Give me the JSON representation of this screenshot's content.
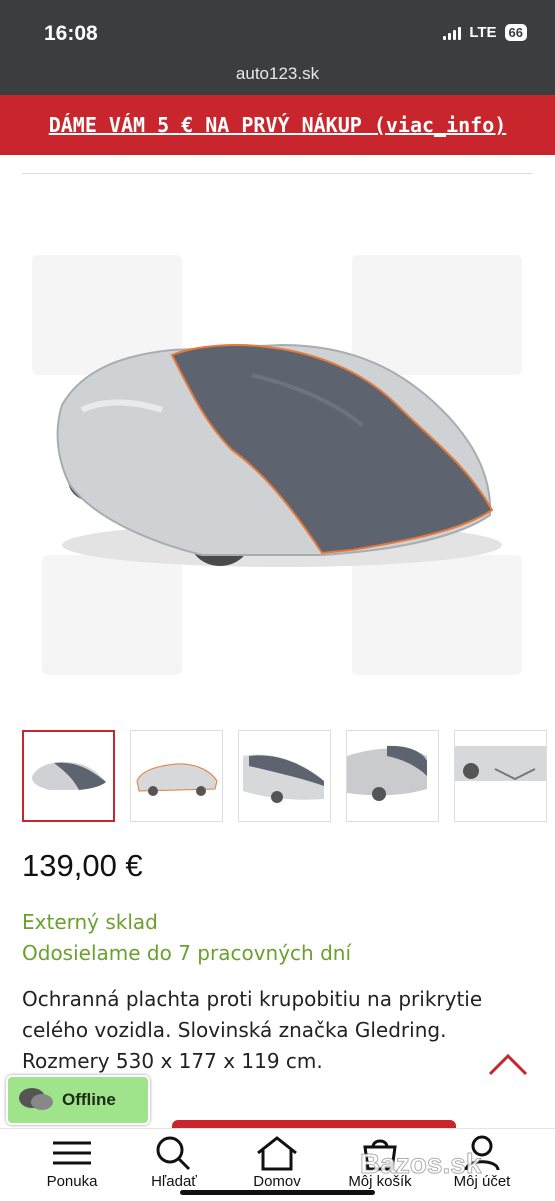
{
  "status_bar": {
    "time": "16:08",
    "network": "LTE",
    "battery": "66"
  },
  "browser": {
    "url": "auto123.sk"
  },
  "promo": {
    "text": "DÁME VÁM 5 € NA PRVÝ NÁKUP (viac_info)"
  },
  "product": {
    "image_icon": "car-cover-image",
    "thumbnails": [
      {
        "icon": "car-cover-thumbnail",
        "selected": true
      },
      {
        "icon": "car-cover-side-thumbnail",
        "selected": false
      },
      {
        "icon": "car-cover-front-thumbnail",
        "selected": false
      },
      {
        "icon": "car-cover-closeup-thumbnail",
        "selected": false
      },
      {
        "icon": "car-cover-wheel-thumbnail",
        "selected": false
      }
    ],
    "price": "139,00 €",
    "stock_status": "Externý sklad",
    "shipping": "Odosielame do 7 pracovných dní",
    "description": "Ochranná plachta proti krupobitiu na prikrytie celého vozidla. Slovinská značka Gledring. Rozmery 530 x 177 x 119 cm."
  },
  "chat": {
    "label": "Offline",
    "icon": "chat-bubbles-icon"
  },
  "bottom_nav": [
    {
      "label": "Ponuka",
      "icon": "menu-icon"
    },
    {
      "label": "Hľadať",
      "icon": "search-icon"
    },
    {
      "label": "Domov",
      "icon": "home-icon"
    },
    {
      "label": "Môj košík",
      "icon": "cart-icon"
    },
    {
      "label": "Môj účet",
      "icon": "user-icon"
    }
  ],
  "watermark": "Bazos.sk",
  "colors": {
    "accent_red": "#c8252c",
    "stock_green": "#6aa12d",
    "status_bar": "#3b3d3e"
  }
}
